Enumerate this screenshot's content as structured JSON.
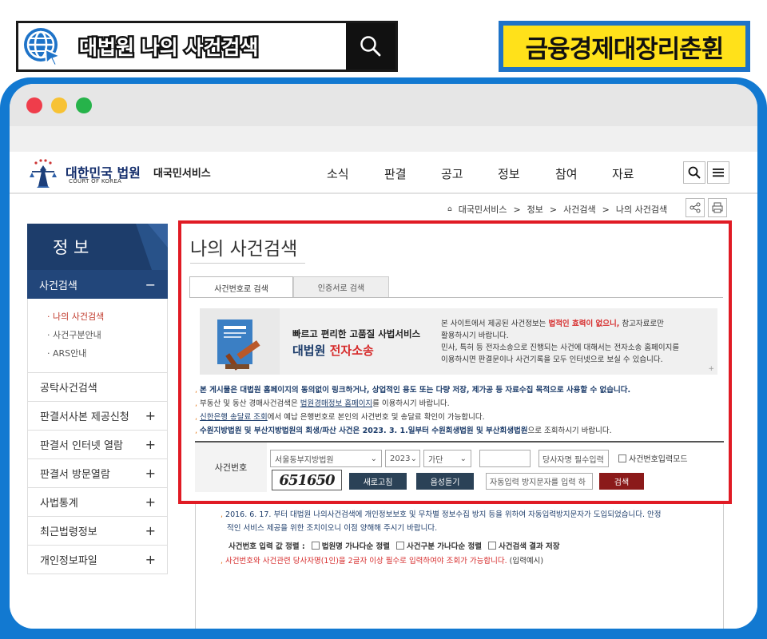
{
  "banner": {
    "search_text": "대법원 나의 사건검색",
    "channel_name": "금융경제대장리춘휜"
  },
  "site": {
    "logo_title": "대한민국 법원",
    "logo_sub": "COURT OF KOREA",
    "service_name": "대국민서비스",
    "nav": [
      "소식",
      "판결",
      "공고",
      "정보",
      "참여",
      "자료"
    ]
  },
  "breadcrumb": [
    "대국민서비스",
    "정보",
    "사건검색",
    "나의 사건검색"
  ],
  "sidebar": {
    "heading": "정 보",
    "active": "사건검색",
    "active_toggle": "−",
    "subitems": [
      "나의 사건검색",
      "사건구분안내",
      "ARS안내"
    ],
    "items": [
      {
        "label": "공탁사건검색",
        "toggle": ""
      },
      {
        "label": "판결서사본 제공신청",
        "toggle": "+"
      },
      {
        "label": "판결서 인터넷 열람",
        "toggle": "+"
      },
      {
        "label": "판결서 방문열람",
        "toggle": "+"
      },
      {
        "label": "사법통계",
        "toggle": "+"
      },
      {
        "label": "최근법령정보",
        "toggle": "+"
      },
      {
        "label": "개인정보파일",
        "toggle": "+"
      }
    ]
  },
  "content": {
    "title": "나의 사건검색",
    "tabs": [
      "사건번호로 검색",
      "인증서로 검색"
    ],
    "promo": {
      "line1": "빠르고 편리한 고품질 사법서비스",
      "line2a": "대법원 ",
      "line2b": "전자소송",
      "right1a": "본 사이트에서 제공된 사건정보는 ",
      "right1b": "법적인 효력이 없으니,",
      "right1c": " 참고자료로만",
      "right2": "활용하시기 바랍니다.",
      "right3": "민사, 특허 등 전자소송으로 진행되는 사건에 대해서는 전자소송 홈페이지를",
      "right4": "이용하시면 판결문이나 사건기록을 모두 인터넷으로 보실 수 있습니다."
    },
    "notices": [
      {
        "a": "본 게시물은 대법원 홈페이지의 동의없이 링크하거나, 상업적인 용도 또는 다량 저장, 제가공 등 자료수집 목적으로 사용할 수 없습니다.",
        "b": "",
        "c": ""
      },
      {
        "a": "부동산 및 동산 경매사건검색은 ",
        "b": "법원경매정보 홈페이지",
        "c": "를 이용하시기 바랍니다."
      },
      {
        "a": "",
        "b": "신한은행 송달료 조회",
        "c": "에서 예납 은행번호로 본인의 사건번호 및 송달료 확인이 가능합니다."
      },
      {
        "a": "수원지방법원 및 부산지방법원의 회생/파산 사건은 2023. 3. 1.일부터 수원회생법원 및 부산회생법원",
        "b": "",
        "c": "으로 조회하시기 바랍니다."
      }
    ],
    "form": {
      "label": "사건번호",
      "court": "서울동부지방법원",
      "year": "2023",
      "case_type": "가단",
      "case_number": "",
      "party_placeholder": "당사자명 필수입력",
      "mode_label": "사건번호입력모드",
      "captcha": "651650",
      "refresh_button": "새로고침",
      "audio_button": "음성듣기",
      "captcha_placeholder": "자동입력 방지문자를 입력 하",
      "search_button": "검색"
    },
    "footer_notice1": "2016. 6. 17. 부터 대법원 나의사건검색에 개인정보보호 및 무차별 정보수집 방지 등을 위하여 자동입력방지문자가 도입되었습니다. 안정",
    "footer_notice2": "적인 서비스 제공을 위한 조치이오니 이점 양해해 주시기 바랍니다.",
    "sort_label": "사건번호 입력 값 정렬 :",
    "sort_options": [
      "법원명 가나다순 정렬",
      "사건구분 가나다순 정렬",
      "사건검색 결과 저장"
    ],
    "warning_red": "사건번호와 사건관련 당사자명(1인)을 2글자 이상 필수로 입력하여야 조회가 가능합니다.",
    "warning_tail": " (입력예시)"
  },
  "colors": {
    "frame_blue": "#1279d1",
    "highlight_red": "#e01b24",
    "side_navy": "#1d3d6b",
    "channel_yellow": "#ffe11a"
  }
}
